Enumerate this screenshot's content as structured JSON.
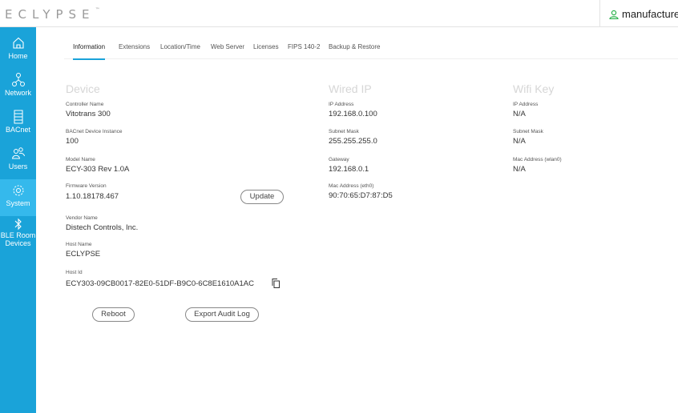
{
  "header": {
    "logo_text": "ECLYPSE",
    "logo_tm": "™",
    "user_name": "manufacturer",
    "user_icon": "user-icon"
  },
  "sidebar": {
    "items": [
      {
        "label": "Home",
        "icon": "home-icon",
        "active": false
      },
      {
        "label": "Network",
        "icon": "network-icon",
        "active": false
      },
      {
        "label": "BACnet",
        "icon": "bacnet-icon",
        "active": false
      },
      {
        "label": "Users",
        "icon": "users-icon",
        "active": false
      },
      {
        "label": "System",
        "icon": "gear-icon",
        "active": true
      },
      {
        "label": "BLE Room",
        "label2": "Devices",
        "icon": "bluetooth-icon",
        "active": false
      }
    ]
  },
  "tabs": [
    {
      "label": "Information",
      "active": true
    },
    {
      "label": "Extensions",
      "active": false
    },
    {
      "label": "Location/Time",
      "active": false
    },
    {
      "label": "Web Server",
      "active": false
    },
    {
      "label": "Licenses",
      "active": false
    },
    {
      "label": "FIPS 140-2",
      "active": false
    },
    {
      "label": "Backup & Restore",
      "active": false
    }
  ],
  "device": {
    "title": "Device",
    "fields": [
      {
        "label": "Controller Name",
        "value": "Vitotrans 300"
      },
      {
        "label": "BACnet Device Instance",
        "value": "100"
      },
      {
        "label": "Model Name",
        "value": "ECY-303 Rev 1.0A"
      },
      {
        "label": "Firmware Version",
        "value": "1.10.18178.467"
      },
      {
        "label": "Vendor Name",
        "value": "Distech Controls, Inc."
      },
      {
        "label": "Host Name",
        "value": "ECLYPSE"
      },
      {
        "label": "Host Id",
        "value": "ECY303-09CB0017-82E0-51DF-B9C0-6C8E1610A1AC"
      }
    ],
    "update_button": "Update",
    "copy_icon": "copy-icon"
  },
  "wired_ip": {
    "title": "Wired IP",
    "fields": [
      {
        "label": "IP Address",
        "value": "192.168.0.100"
      },
      {
        "label": "Subnet Mask",
        "value": "255.255.255.0"
      },
      {
        "label": "Gateway",
        "value": "192.168.0.1"
      },
      {
        "label": "Mac Address (eth0)",
        "value": "90:70:65:D7:87:D5"
      }
    ]
  },
  "wifi_key": {
    "title": "Wifi Key",
    "fields": [
      {
        "label": "IP Address",
        "value": "N/A"
      },
      {
        "label": "Subnet Mask",
        "value": "N/A"
      },
      {
        "label": "Mac Address (wlan0)",
        "value": "N/A"
      }
    ]
  },
  "actions": {
    "reboot": "Reboot",
    "export_audit_log": "Export Audit Log"
  },
  "colors": {
    "accent": "#1aa3d9",
    "sidebar_active": "#35b9ec",
    "user_icon": "#2bb24c"
  }
}
